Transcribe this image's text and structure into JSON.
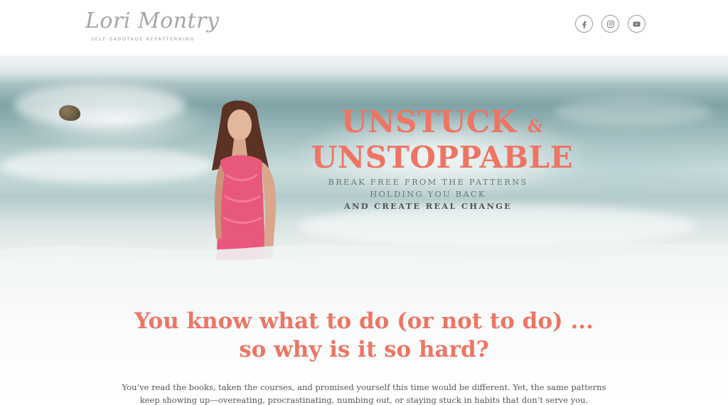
{
  "header": {
    "logo_text": "Lori Montry",
    "logo_tagline": "SELF-SABOTAGE REPATTERNING",
    "social": [
      {
        "name": "facebook",
        "icon": "facebook-icon"
      },
      {
        "name": "instagram",
        "icon": "instagram-icon"
      },
      {
        "name": "youtube",
        "icon": "youtube-icon"
      }
    ]
  },
  "hero": {
    "title_line1": "UNSTUCK",
    "title_amp": "&",
    "title_line2": "UNSTOPPABLE",
    "subtitle_line1": "BREAK FREE FROM THE PATTERNS",
    "subtitle_line2": "HOLDING YOU BACK",
    "subtitle_line3": "AND CREATE REAL CHANGE"
  },
  "main": {
    "headline_line1": "You know what to do (or not to do) ...",
    "headline_line2": "so why is it so hard?",
    "body_line1": "You’ve read the books, taken the courses, and promised yourself this time would be different. Yet, the same patterns",
    "body_line2": "keep showing up—overeating, procrastinating, numbing out, or staying stuck in habits that don’t serve you."
  },
  "colors": {
    "accent": "#ee7564",
    "icon_gray": "#7a7a7a",
    "text_gray": "#555555"
  }
}
